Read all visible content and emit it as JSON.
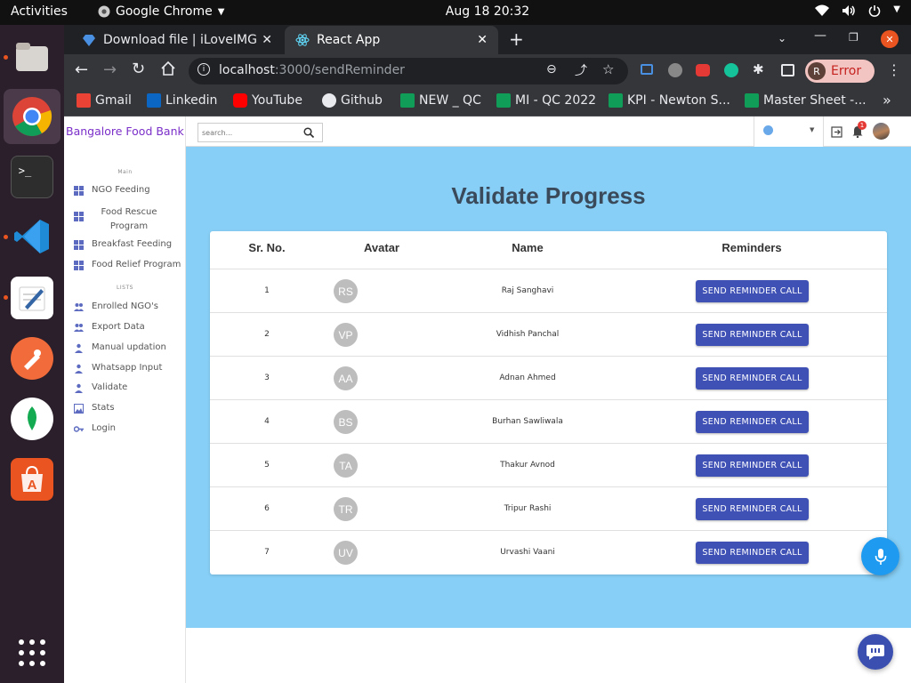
{
  "desktop": {
    "activities": "Activities",
    "app_name": "Google Chrome",
    "clock": "Aug 18  20:32"
  },
  "browser": {
    "tabs": [
      {
        "label": "Download file | iLoveIMG"
      },
      {
        "label": "React App"
      }
    ],
    "url_host": "localhost",
    "url_path": ":3000/sendReminder",
    "profile_initial": "R",
    "profile_status": "Error",
    "bookmarks": [
      {
        "label": "Gmail",
        "color": "#ea4335"
      },
      {
        "label": "Linkedin",
        "color": "#0a66c2"
      },
      {
        "label": "YouTube",
        "color": "#ff0000"
      },
      {
        "label": "Github",
        "color": "#e8eaed"
      },
      {
        "label": "NEW _ QC",
        "color": "#0f9d58"
      },
      {
        "label": "MI - QC 2022",
        "color": "#0f9d58"
      },
      {
        "label": "KPI - Newton S...",
        "color": "#0f9d58"
      },
      {
        "label": "Master Sheet -...",
        "color": "#0f9d58"
      }
    ]
  },
  "app": {
    "brand": "Bangalore Food Bank",
    "search_placeholder": "search...",
    "notification_count": "1",
    "sidebar": {
      "section_main": "Main",
      "section_lists": "LISTS",
      "main_items": [
        {
          "label": "NGO Feeding"
        },
        {
          "label": "Food Rescue Program"
        },
        {
          "label": "Breakfast Feeding"
        },
        {
          "label": "Food Relief Program"
        }
      ],
      "list_items": [
        {
          "label": "Enrolled NGO's"
        },
        {
          "label": "Export Data"
        },
        {
          "label": "Manual updation"
        },
        {
          "label": "Whatsapp Input"
        },
        {
          "label": "Validate"
        },
        {
          "label": "Stats"
        },
        {
          "label": "Login"
        }
      ]
    },
    "page_title": "Validate Progress",
    "table": {
      "headers": [
        "Sr. No.",
        "Avatar",
        "Name",
        "Reminders"
      ],
      "button_label": "SEND REMINDER CALL",
      "rows": [
        {
          "sr": "1",
          "initials": "RS",
          "name": "Raj Sanghavi"
        },
        {
          "sr": "2",
          "initials": "VP",
          "name": "Vidhish Panchal"
        },
        {
          "sr": "3",
          "initials": "AA",
          "name": "Adnan Ahmed"
        },
        {
          "sr": "4",
          "initials": "BS",
          "name": "Burhan Sawliwala"
        },
        {
          "sr": "5",
          "initials": "TA",
          "name": "Thakur Avnod"
        },
        {
          "sr": "6",
          "initials": "TR",
          "name": "Tripur Rashi"
        },
        {
          "sr": "7",
          "initials": "UV",
          "name": "Urvashi Vaani"
        }
      ]
    }
  }
}
